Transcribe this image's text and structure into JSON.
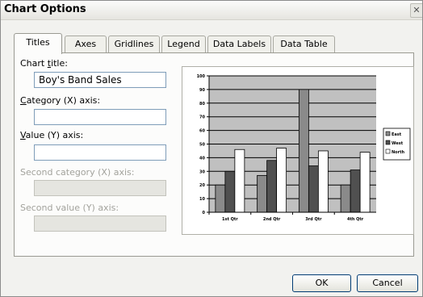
{
  "window": {
    "title": "Chart Options",
    "close_glyph": "✕"
  },
  "tabs": [
    {
      "label": "Titles",
      "active": true
    },
    {
      "label": "Axes"
    },
    {
      "label": "Gridlines"
    },
    {
      "label": "Legend"
    },
    {
      "label": "Data Labels"
    },
    {
      "label": "Data Table"
    }
  ],
  "form": {
    "chart_title": {
      "pre": "Chart ",
      "key": "t",
      "post": "itle:",
      "value": "Boy's Band Sales"
    },
    "category_x": {
      "pre": "",
      "key": "C",
      "post": "ategory (X) axis:",
      "value": ""
    },
    "value_y": {
      "pre": "",
      "key": "V",
      "post": "alue (Y) axis:",
      "value": ""
    },
    "second_category_x": {
      "label": "Second category (X) axis:",
      "value": ""
    },
    "second_value_y": {
      "label": "Second value (Y) axis:",
      "value": ""
    }
  },
  "chart_data": {
    "type": "bar",
    "categories": [
      "1st Qtr",
      "2nd Qtr",
      "3rd Qtr",
      "4th Qtr"
    ],
    "series": [
      {
        "name": "East",
        "values": [
          20,
          27,
          90,
          20
        ],
        "color": "#8a8a8a"
      },
      {
        "name": "West",
        "values": [
          30,
          38,
          34,
          31
        ],
        "color": "#505050"
      },
      {
        "name": "North",
        "values": [
          46,
          47,
          45,
          44
        ],
        "color": "#ffffff"
      }
    ],
    "ylim": [
      0,
      100
    ],
    "yticks": [
      "0",
      "10",
      "20",
      "30",
      "40",
      "50",
      "60",
      "70",
      "80",
      "90",
      "100"
    ],
    "plot_background": "#c0c0c0",
    "grid": true,
    "legend_position": "right"
  },
  "buttons": {
    "ok": "OK",
    "cancel": "Cancel"
  },
  "colors": {
    "field_border": "#7f9db9",
    "button_border": "#003c74",
    "disabled_text": "#a2a29c"
  }
}
